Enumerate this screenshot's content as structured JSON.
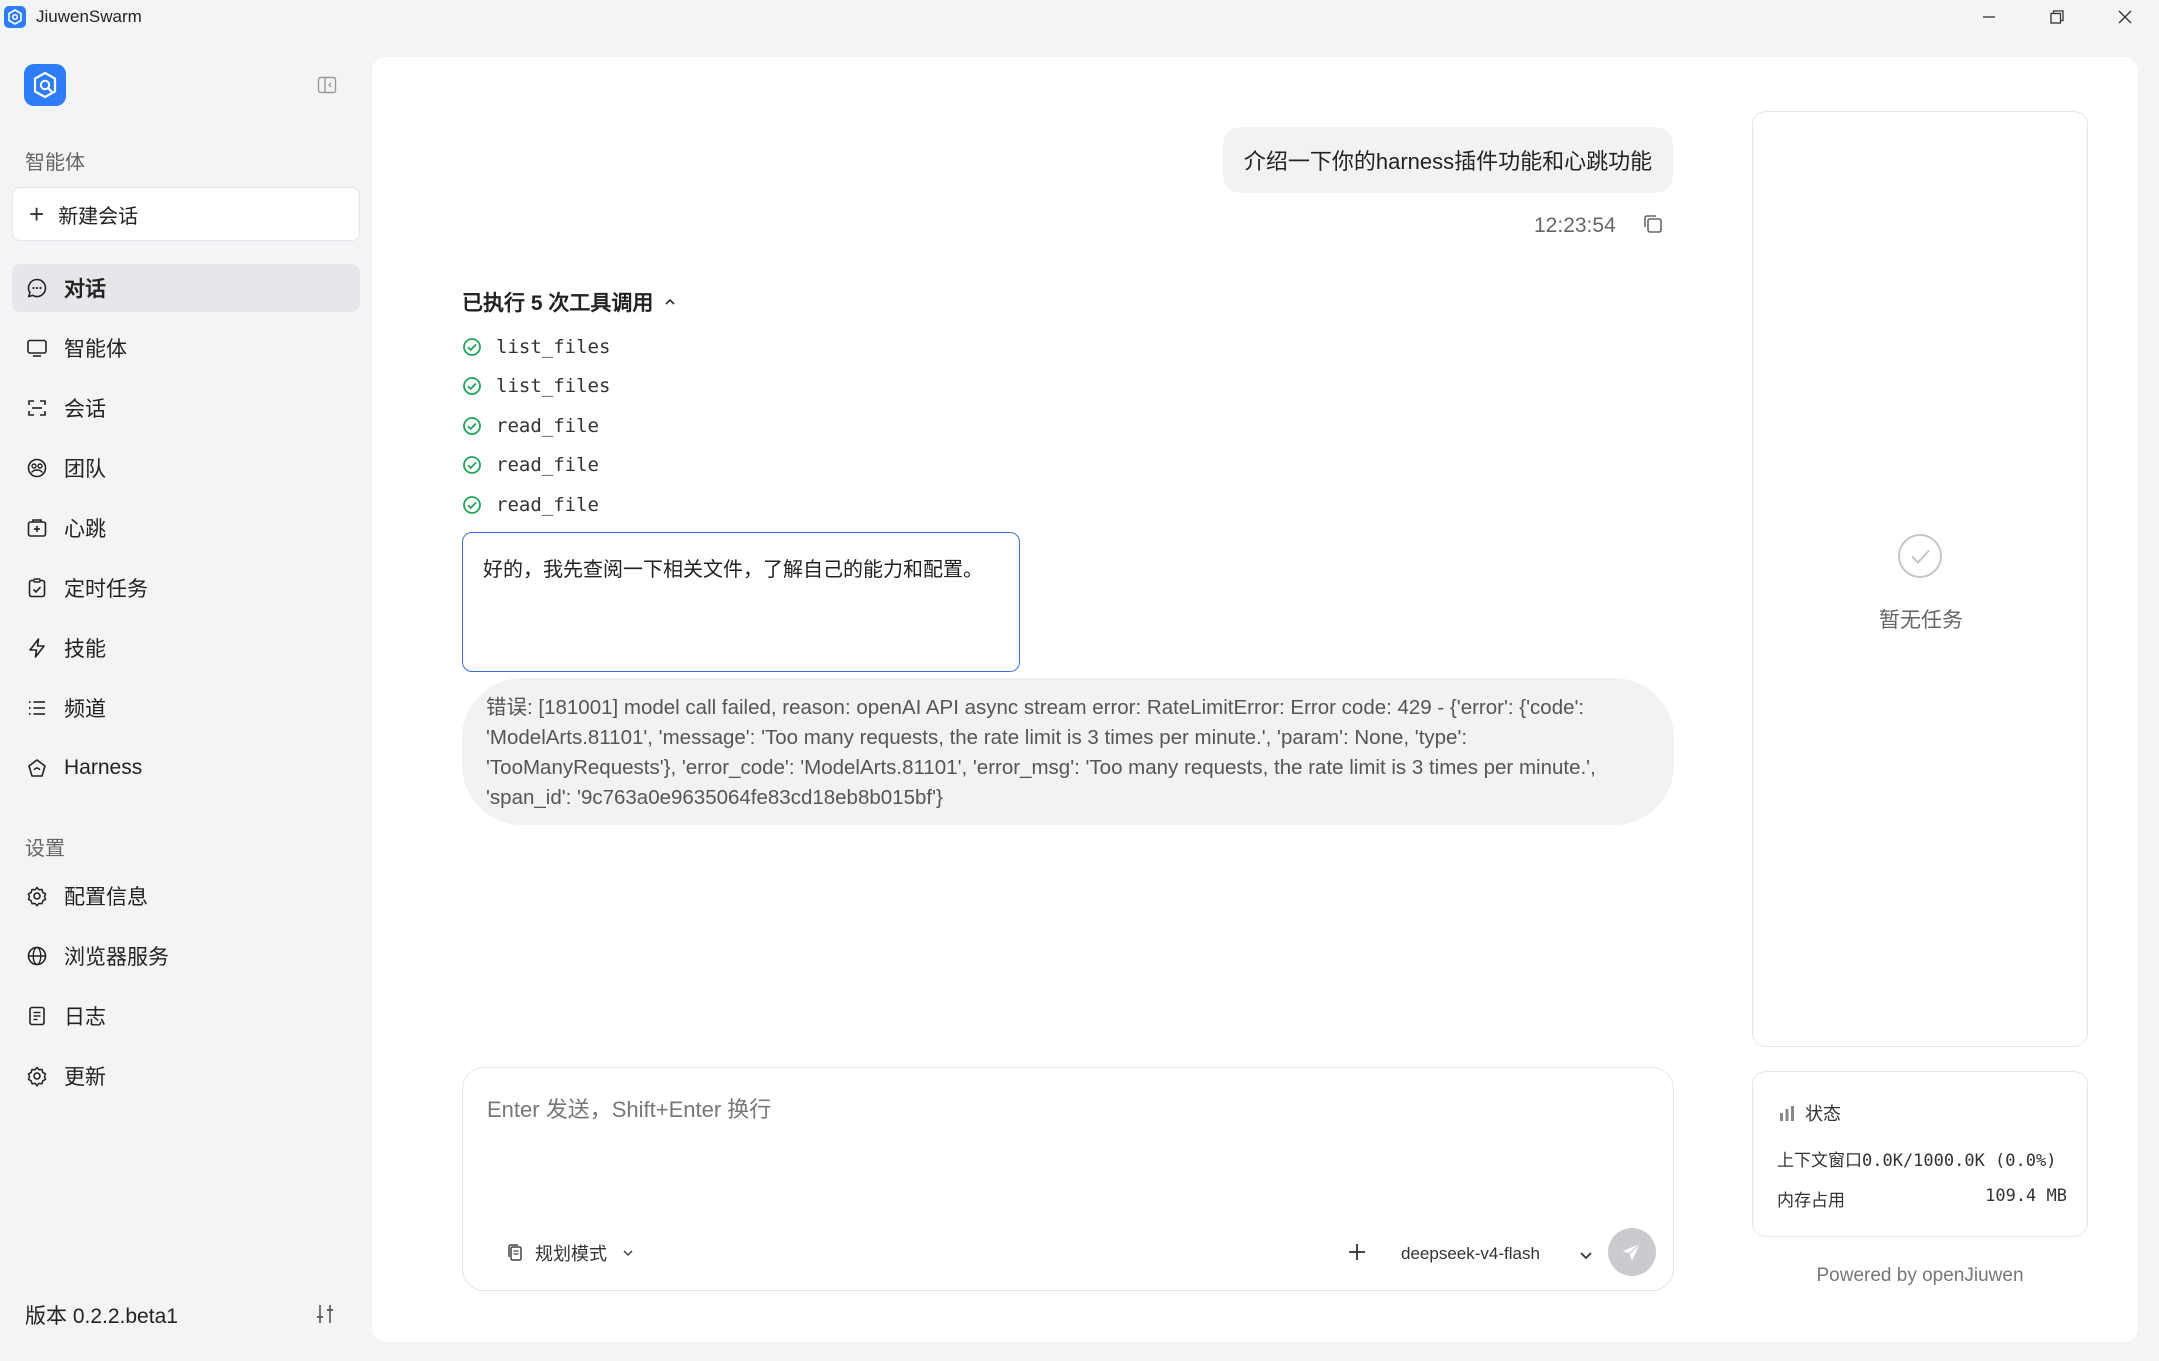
{
  "window": {
    "title": "JiuwenSwarm"
  },
  "sidebar": {
    "section_agents": "智能体",
    "new_chat_label": "新建会话",
    "nav": [
      {
        "label": "对话",
        "icon": "chat-bubble-icon"
      },
      {
        "label": "智能体",
        "icon": "monitor-icon"
      },
      {
        "label": "会话",
        "icon": "session-icon"
      },
      {
        "label": "团队",
        "icon": "team-icon"
      },
      {
        "label": "心跳",
        "icon": "heartbeat-icon"
      },
      {
        "label": "定时任务",
        "icon": "clipboard-clock-icon"
      },
      {
        "label": "技能",
        "icon": "lightning-icon"
      },
      {
        "label": "频道",
        "icon": "list-icon"
      },
      {
        "label": "Harness",
        "icon": "harness-icon"
      }
    ],
    "section_settings": "设置",
    "settings": [
      {
        "label": "配置信息",
        "icon": "gear-icon"
      },
      {
        "label": "浏览器服务",
        "icon": "globe-icon"
      },
      {
        "label": "日志",
        "icon": "log-icon"
      },
      {
        "label": "更新",
        "icon": "update-gear-icon"
      }
    ],
    "version": "版本 0.2.2.beta1"
  },
  "chat": {
    "user_message": "介绍一下你的harness插件功能和心跳功能",
    "user_time": "12:23:54",
    "tool_header": "已执行 5 次工具调用",
    "tool_calls": [
      "list_files",
      "list_files",
      "read_file",
      "read_file",
      "read_file"
    ],
    "assistant_message": "好的，我先查阅一下相关文件，了解自己的能力和配置。",
    "error_message": "错误: [181001] model call failed, reason: openAI API async stream error: RateLimitError: Error code: 429 - {'error': {'code': 'ModelArts.81101', 'message': 'Too many requests, the rate limit is 3 times per minute.', 'param': None, 'type': 'TooManyRequests'}, 'error_code': 'ModelArts.81101', 'error_msg': 'Too many requests, the rate limit is 3 times per minute.', 'span_id': '9c763a0e9635064fe83cd18eb8b015bf'}"
  },
  "composer": {
    "placeholder": "Enter 发送，Shift+Enter 换行",
    "mode": "规划模式",
    "model": "deepseek-v4-flash"
  },
  "tasks": {
    "empty_text": "暂无任务"
  },
  "status": {
    "title": "状态",
    "context_label": "上下文窗口",
    "context_value": "0.0K/1000.0K (0.0%)",
    "memory_label": "内存占用",
    "memory_value": "109.4 MB"
  },
  "footer": {
    "powered": "Powered by openJiuwen"
  },
  "colors": {
    "accent": "#2f7df6",
    "success": "#22a45a",
    "focus_border": "#3b6fe0"
  }
}
